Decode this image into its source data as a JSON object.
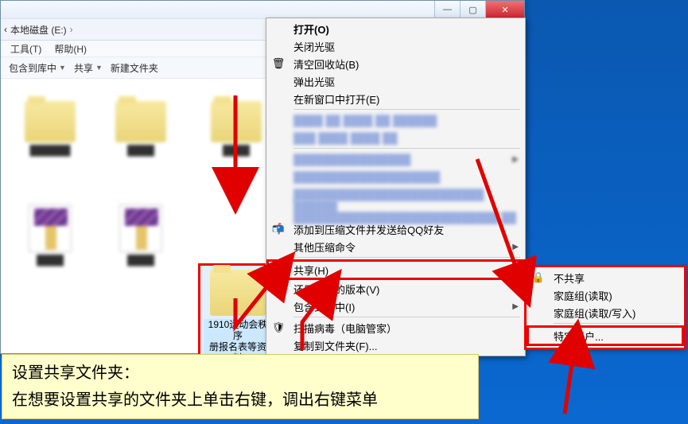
{
  "window": {
    "min": "—",
    "max": "▢",
    "close": "✕"
  },
  "breadcrumb": {
    "arrow": "‹",
    "disk": "本地磁盘 (E:)",
    "sep": "›"
  },
  "menubar": {
    "tools": "工具(T)",
    "help": "帮助(H)"
  },
  "toolbar": {
    "include": "包含到库中",
    "share": "共享",
    "newfolder": "新建文件夹"
  },
  "folder": {
    "name1": "1910运动会秩序",
    "name2": "册报名表等资料"
  },
  "ctx": {
    "open": "打开(O)",
    "closeDrive": "关闭光驱",
    "emptyBin": "清空回收站(B)",
    "eject": "弹出光驱",
    "newWindow": "在新窗口中打开(E)",
    "addQQ": "添加到压缩文件并发送给QQ好友",
    "otherZip": "其他压缩命令",
    "share": "共享(H)",
    "restore": "还原以前的版本(V)",
    "include": "包含到库中(I)",
    "scan": "扫描病毒（电脑管家）",
    "copyF": "复制到文件夹(F)..."
  },
  "sub": {
    "noshare": "不共享",
    "hgread": "家庭组(读取)",
    "hgrw": "家庭组(读取/写入)",
    "specific": "特定用户..."
  },
  "annot": {
    "line1": "设置共享文件夹：",
    "line2": "在想要设置共享的文件夹上单击右键，调出右键菜单"
  }
}
